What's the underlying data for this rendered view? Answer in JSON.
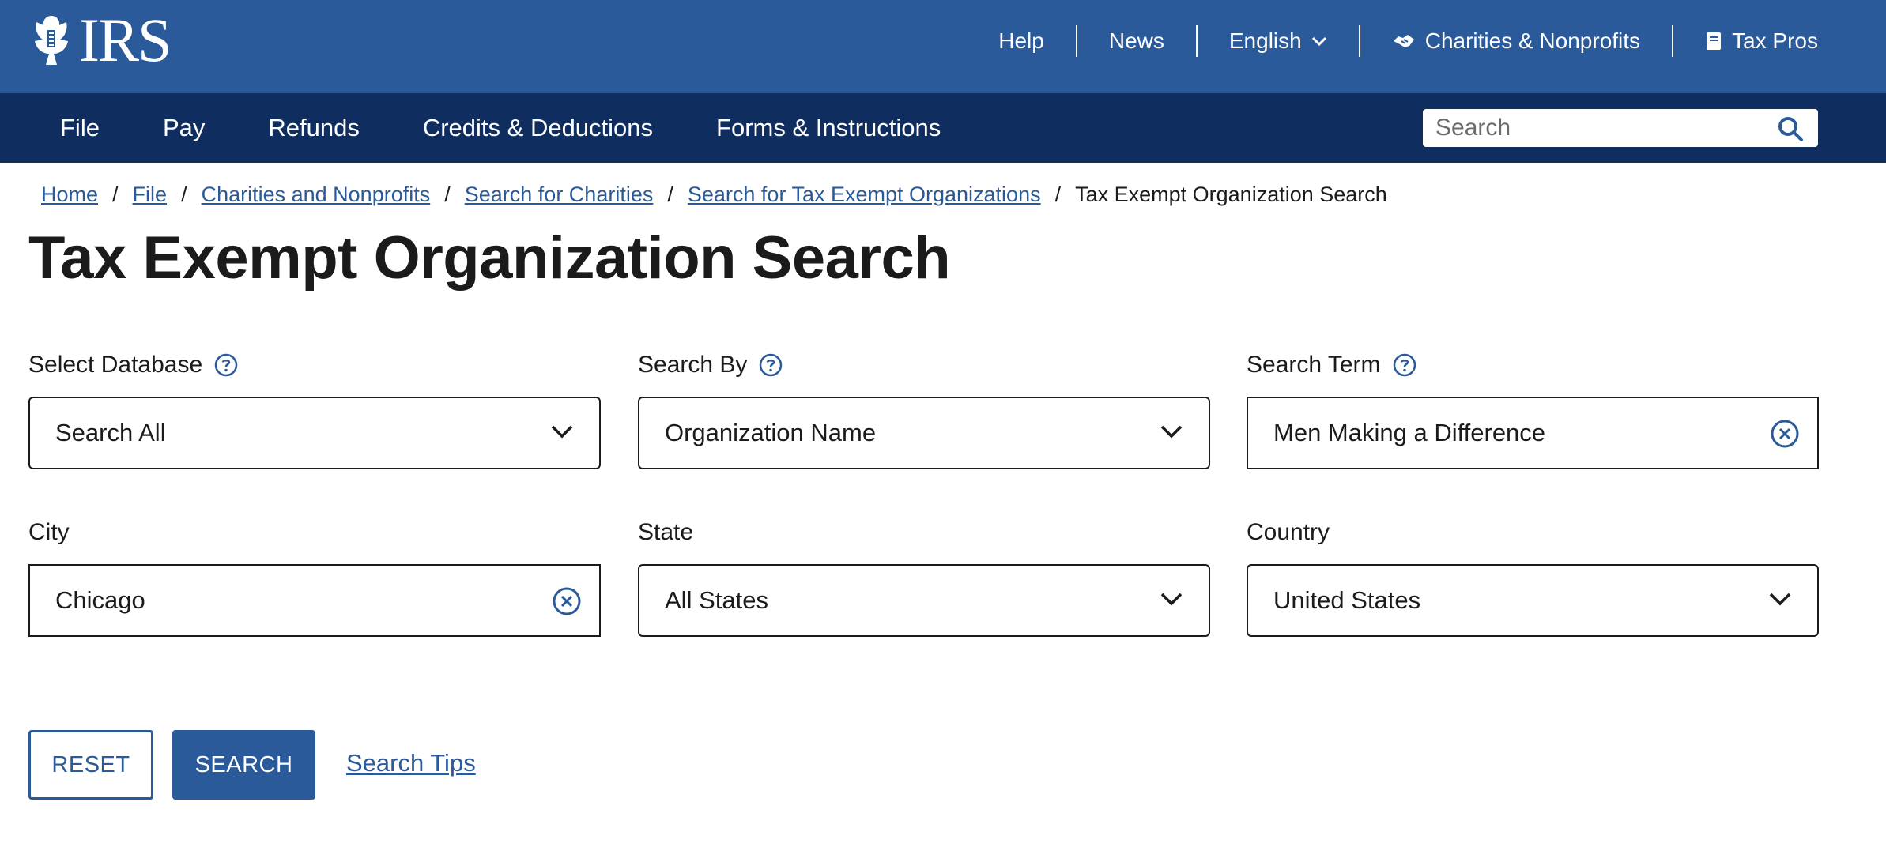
{
  "header": {
    "logo_text": "IRS",
    "links": {
      "help": "Help",
      "news": "News",
      "language": "English",
      "charities": "Charities & Nonprofits",
      "taxpros": "Tax Pros"
    }
  },
  "nav": {
    "items": [
      "File",
      "Pay",
      "Refunds",
      "Credits & Deductions",
      "Forms & Instructions"
    ],
    "search_placeholder": "Search"
  },
  "breadcrumb": {
    "items": [
      "Home",
      "File",
      "Charities and Nonprofits",
      "Search for Charities",
      "Search for Tax Exempt Organizations"
    ],
    "current": "Tax Exempt Organization Search",
    "separator": "/"
  },
  "page_title": "Tax Exempt Organization Search",
  "form": {
    "database": {
      "label": "Select Database",
      "value": "Search All"
    },
    "search_by": {
      "label": "Search By",
      "value": "Organization Name"
    },
    "search_term": {
      "label": "Search Term",
      "value": "Men Making a Difference"
    },
    "city": {
      "label": "City",
      "value": "Chicago"
    },
    "state": {
      "label": "State",
      "value": "All States"
    },
    "country": {
      "label": "Country",
      "value": "United States"
    }
  },
  "actions": {
    "reset": "RESET",
    "search": "SEARCH",
    "tips": "Search Tips"
  },
  "icons": {
    "eagle": "eagle-logo-icon",
    "chevron": "chevron-down-icon",
    "help": "question-circle-icon",
    "clear": "clear-circle-icon",
    "search": "search-icon",
    "handshake": "handshake-icon",
    "book": "book-icon"
  },
  "colors": {
    "topbar": "#2a5a99",
    "navbar": "#0f2d5e",
    "link": "#2a5a99",
    "text": "#1b1b1b"
  }
}
